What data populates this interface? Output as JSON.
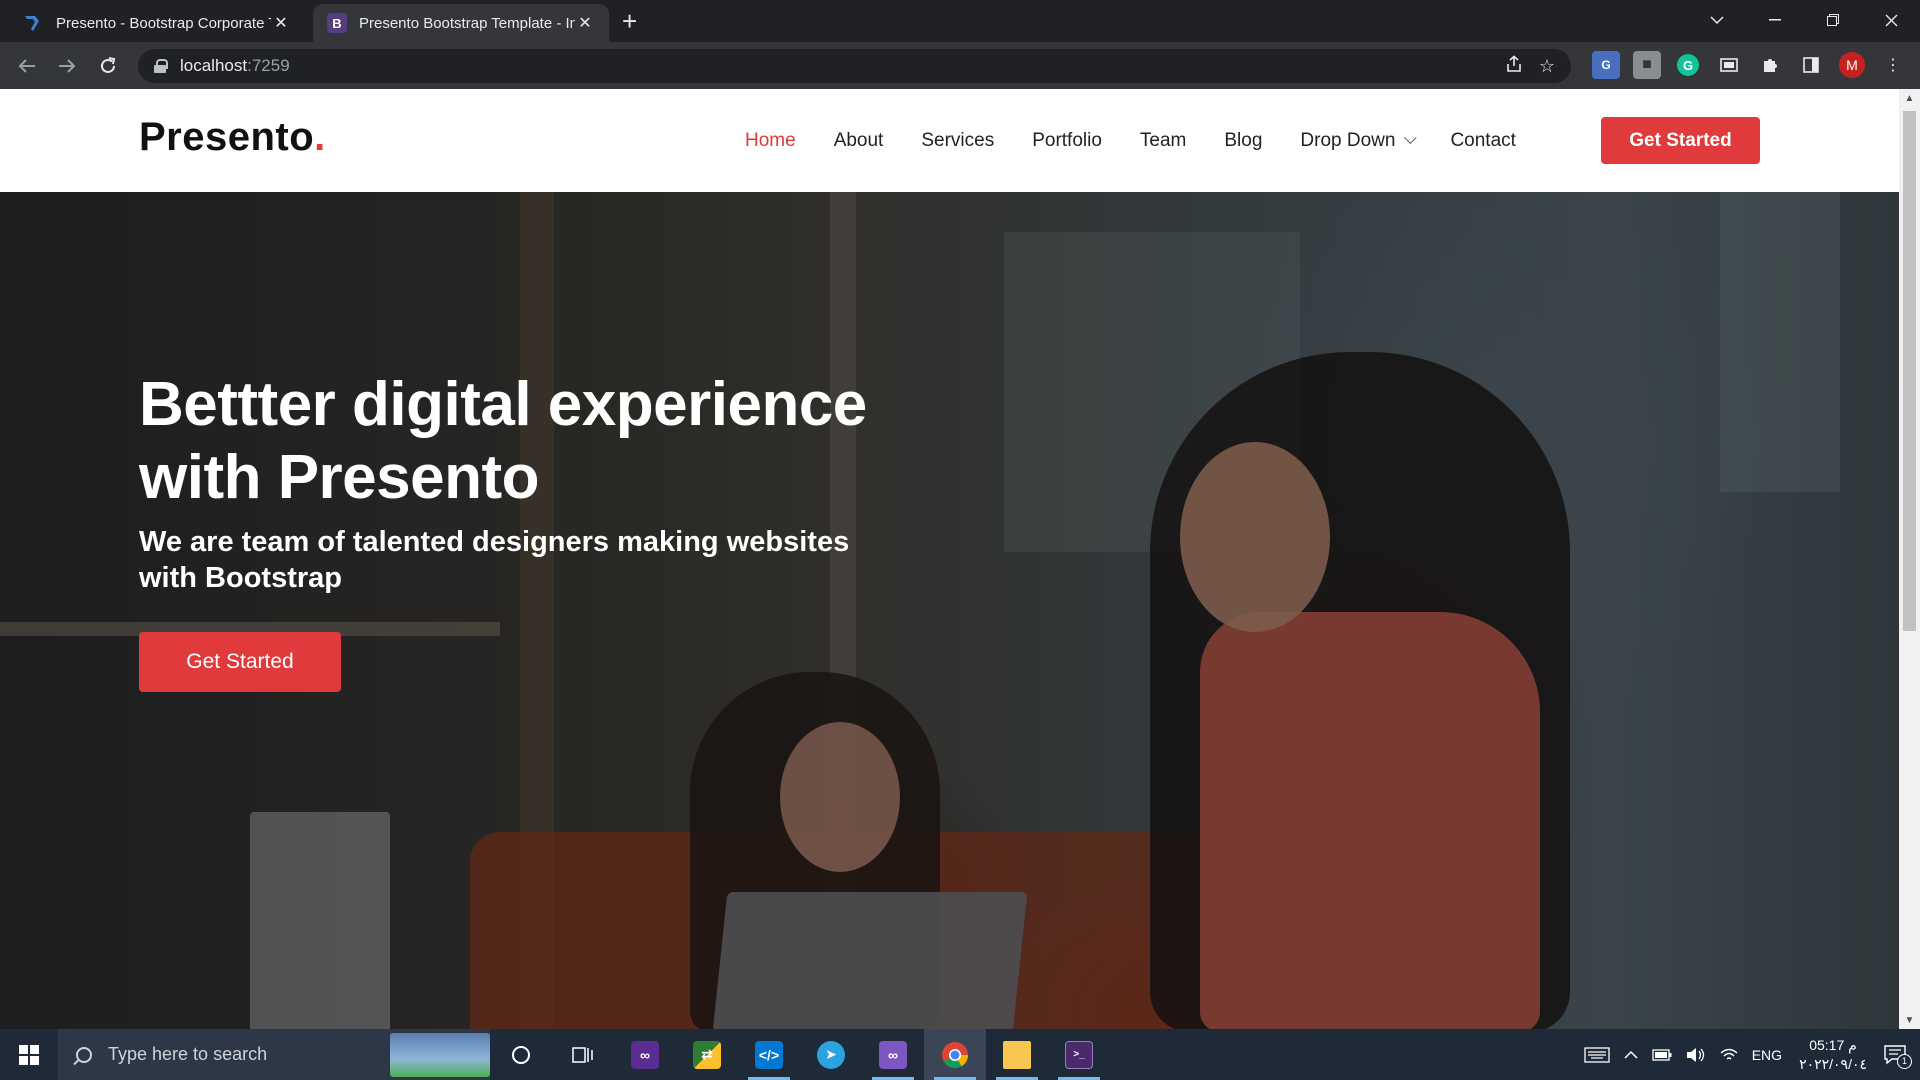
{
  "browser": {
    "tabs": [
      {
        "title": "Presento - Bootstrap Corporate T",
        "active": false
      },
      {
        "title": "Presento Bootstrap Template - In",
        "active": true
      }
    ],
    "bootstrap_favicon_letter": "B",
    "url_host": "localhost",
    "url_port": ":7259",
    "profile_initial": "M",
    "translate_label": "G"
  },
  "site": {
    "logo_text": "Presento",
    "logo_dot": ".",
    "nav": [
      {
        "label": "Home",
        "active": true
      },
      {
        "label": "About"
      },
      {
        "label": "Services"
      },
      {
        "label": "Portfolio"
      },
      {
        "label": "Team"
      },
      {
        "label": "Blog"
      },
      {
        "label": "Drop Down",
        "has_dropdown": true
      },
      {
        "label": "Contact"
      }
    ],
    "header_cta": "Get Started",
    "hero": {
      "title_line1": "Bettter digital experience",
      "title_line2": "with Presento",
      "subtitle": "We are team of talented designers making websites with Bootstrap",
      "cta": "Get Started"
    },
    "colors": {
      "accent": "#e03a3c",
      "text": "#222222"
    }
  },
  "taskbar": {
    "search_placeholder": "Type here to search",
    "apps": [
      {
        "name": "cortana-icon"
      },
      {
        "name": "task-view-icon"
      },
      {
        "name": "visual-studio-icon"
      },
      {
        "name": "file-compare-icon"
      },
      {
        "name": "vscode-icon"
      },
      {
        "name": "telegram-icon"
      },
      {
        "name": "visual-studio-preview-icon"
      },
      {
        "name": "chrome-icon"
      },
      {
        "name": "file-explorer-icon"
      },
      {
        "name": "terminal-icon"
      }
    ],
    "language": "ENG",
    "time": "05:17 م",
    "date": "٢٠٢٢/٠٩/٠٤",
    "notification_count": "1"
  }
}
